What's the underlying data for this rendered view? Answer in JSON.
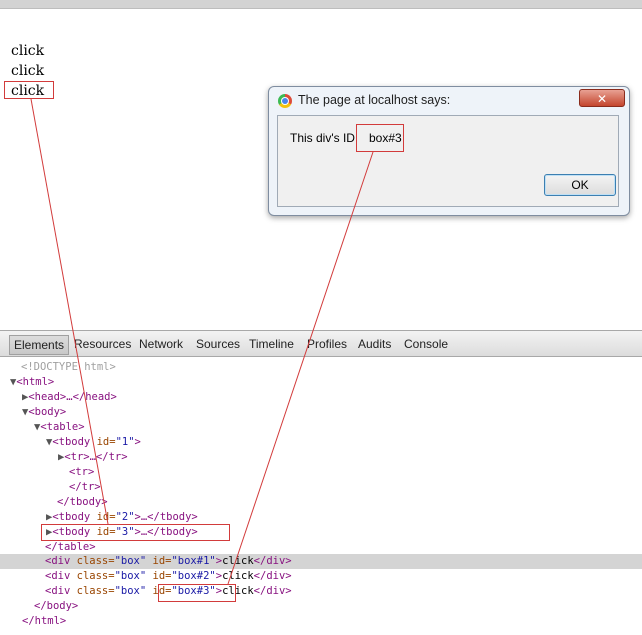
{
  "page": {
    "click_items": [
      "click",
      "click",
      "click"
    ]
  },
  "dialog": {
    "title": "The page at localhost says:",
    "close_label": "✕",
    "message_label": "This div's ID",
    "message_value": "box#3",
    "ok_label": "OK"
  },
  "devtools": {
    "tabs": [
      "Elements",
      "Resources",
      "Network",
      "Sources",
      "Timeline",
      "Profiles",
      "Audits",
      "Console"
    ],
    "lines": {
      "doctype": "<!DOCTYPE html>",
      "html_open": "<html>",
      "head": "<head>…</head>",
      "body_open": "<body>",
      "table_open": "<table>",
      "tbody1_tag": "<tbody",
      "tbody1_attr": " id=",
      "tbody1_val": "\"1\"",
      "tbody1_close": ">",
      "tr1": "<tr>…</tr>",
      "tr2_open": "<tr>",
      "tr2_close": "</tr>",
      "tbody_close": "</tbody>",
      "tbody2_tag": "<tbody",
      "tbody2_attr": " id=",
      "tbody2_val": "\"2\"",
      "tbody2_rest": ">…</tbody>",
      "tbody3_tag": "<tbody",
      "tbody3_attr": " id=",
      "tbody3_val": "\"3\"",
      "tbody3_rest": ">…</tbody>",
      "table_close": "</table>",
      "div_open": "<div",
      "div_class_attr": " class=",
      "div_class_val": "\"box\"",
      "div_id_attr": " id=",
      "div1_id_val": "\"box#1\"",
      "div2_id_val": "\"box#2\"",
      "div3_id_val": "\"box#3\"",
      "div_gt": ">",
      "div_text": "click",
      "div_close": "</div>",
      "body_close": "</body>",
      "html_close": "</html>"
    }
  }
}
